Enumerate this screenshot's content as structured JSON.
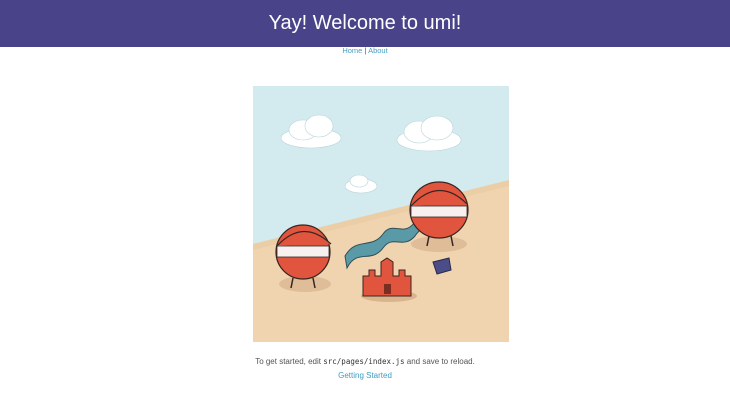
{
  "header": {
    "title": "Yay! Welcome to umi!"
  },
  "nav": {
    "home": "Home",
    "separator": "|",
    "about": "About"
  },
  "main": {
    "caption_prefix": "To get started, edit",
    "caption_code": "src/pages/index.js",
    "caption_suffix": "and save to reload.",
    "link": "Getting Started"
  },
  "colors": {
    "header_bg": "#49448a",
    "link": "#3c9dc1",
    "sky": "#d3ebef",
    "sand": "#f0d4b0",
    "character": "#e1553f"
  },
  "illustration": {
    "subject": "two helmeted umi characters building a sand castle on the beach"
  }
}
